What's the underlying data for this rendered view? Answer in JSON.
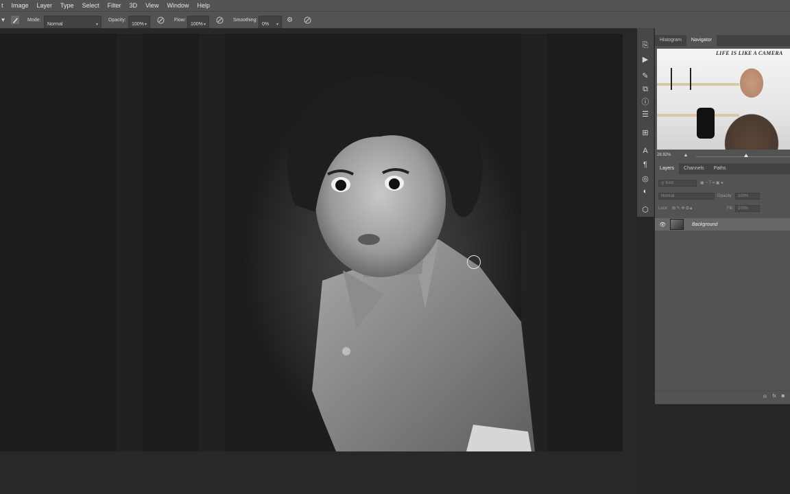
{
  "menu": [
    "t",
    "Image",
    "Layer",
    "Type",
    "Select",
    "Filter",
    "3D",
    "View",
    "Window",
    "Help"
  ],
  "options": {
    "mode_label": "Mode:",
    "mode_value": "Normal",
    "opacity_label": "Opacity:",
    "opacity_value": "100%",
    "flow_label": "Flow:",
    "flow_value": "100%",
    "smoothing_label": "Smoothing:",
    "smoothing_value": "0%"
  },
  "navigator": {
    "tabs": [
      "Histogram",
      "Navigator"
    ],
    "active_tab": "Navigator",
    "zoom": "28.92%",
    "thumbnail_sign": "LIFE IS LIKE A CAMERA"
  },
  "layers": {
    "tabs": [
      "Layers",
      "Channels",
      "Paths"
    ],
    "active_tab": "Layers",
    "filter_placeholder": "Kind",
    "blend_mode": "Normal",
    "opacity_label": "Opacity:",
    "opacity_value": "100%",
    "lock_label": "Lock:",
    "fill_label": "Fill:",
    "fill_value": "100%",
    "items": [
      {
        "name": "Background",
        "visible": true
      }
    ],
    "footer_icons": [
      "link-icon",
      "fx-icon",
      "mask-icon"
    ]
  },
  "icons": {
    "brush_tool": "brush-icon",
    "airbrush": "airbrush-icon",
    "settings": "gear-icon",
    "pressure": "pressure-icon"
  },
  "colors": {
    "ui_dark": "#535353",
    "workspace": "#282828",
    "selected_layer": "#676767"
  }
}
